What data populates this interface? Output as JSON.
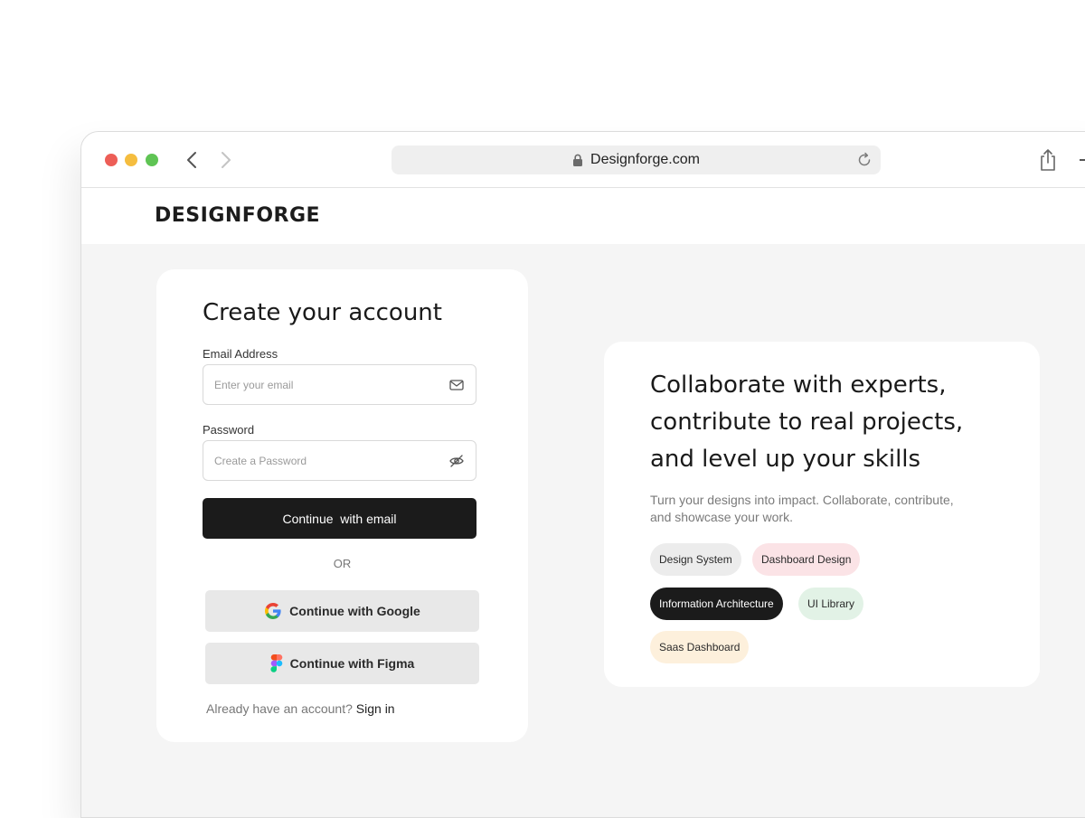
{
  "browser": {
    "url": "Designforge.com",
    "icons": {
      "back": "chevron-left-icon",
      "forward": "chevron-right-icon",
      "lock": "lock-icon",
      "reload": "reload-icon",
      "share": "share-icon"
    }
  },
  "site": {
    "logo": "DESIGNFORGE"
  },
  "signup": {
    "title": "Create your account",
    "email_label": "Email Address",
    "email_placeholder": "Enter your email",
    "email_value": "",
    "password_label": "Password",
    "password_placeholder": "Create a Password",
    "password_value": "",
    "email_button": "Continue  with email",
    "or": "OR",
    "google_button": "Continue with Google",
    "figma_button": "Continue with Figma",
    "signin_prompt": "Already have an account?",
    "signin_link": "Sign in"
  },
  "promo": {
    "headline": "Collaborate with experts, contribute to real projects, and level up your skills",
    "subtext": "Turn your designs into impact. Collaborate, contribute, and showcase your work.",
    "tags": [
      {
        "label": "Design System",
        "bg": "#ececec",
        "color": "#2a2a2a"
      },
      {
        "label": "Dashboard Design",
        "bg": "#fbe3e6",
        "color": "#2a2a2a"
      },
      {
        "label": "Information Architecture",
        "bg": "#1b1b1b",
        "color": "#ffffff"
      },
      {
        "label": "UI Library",
        "bg": "#e2f2e6",
        "color": "#2a2a2a"
      },
      {
        "label": "Saas Dashboard",
        "bg": "#fdf0dc",
        "color": "#2a2a2a"
      }
    ]
  },
  "colors": {
    "primary_button": "#1b1b1b",
    "social_button": "#e8e8e8",
    "page_bg": "#f5f5f5"
  }
}
